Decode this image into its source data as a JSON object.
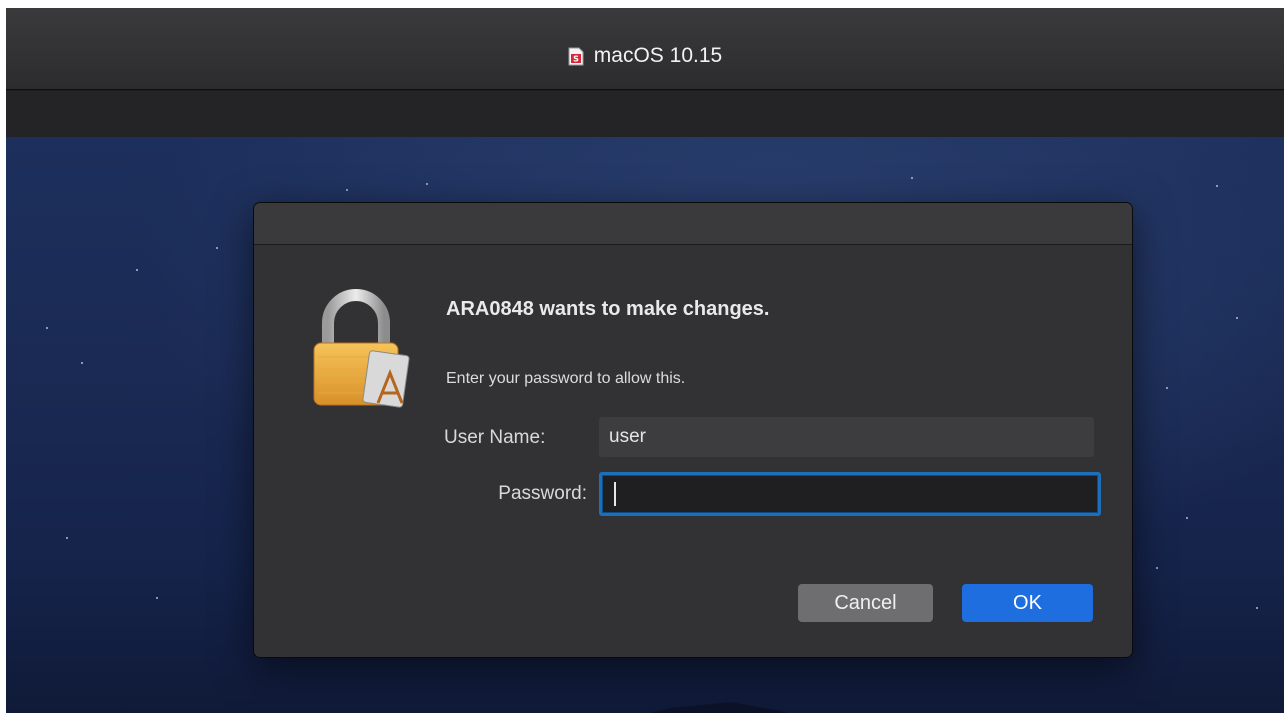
{
  "window": {
    "title": "macOS 10.15",
    "title_icon": "document-app-icon"
  },
  "dialog": {
    "icon": "lock-icon",
    "heading": "ARA0848 wants to make changes.",
    "subtext": "Enter your password to allow this.",
    "username_label": "User Name:",
    "username_value": "user",
    "password_label": "Password:",
    "password_value": "",
    "cancel_label": "Cancel",
    "ok_label": "OK"
  },
  "colors": {
    "accent": "#1f6ee0",
    "focus_ring": "#1c6fba",
    "dialog_bg": "#323234",
    "desktop_bg": "#1a2a54"
  }
}
